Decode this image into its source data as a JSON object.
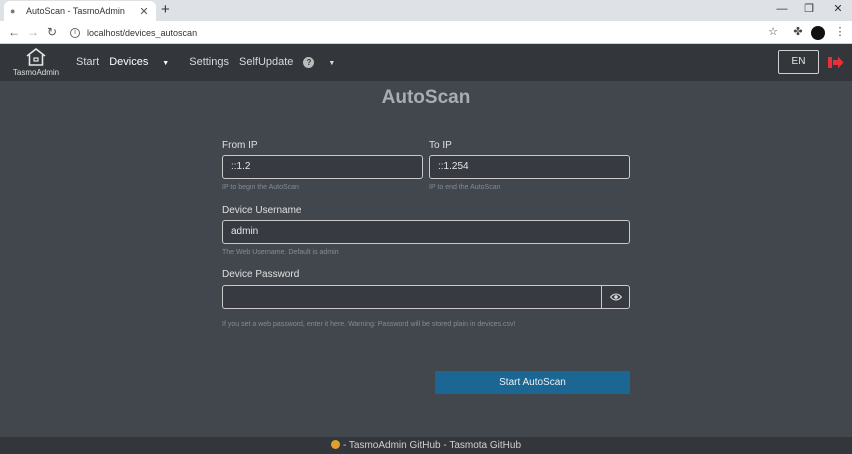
{
  "browser": {
    "tab_title": "AutoScan - TasmoAdmin",
    "tab_close": "✕",
    "new_tab": "+",
    "minimize": "—",
    "restore": "❐",
    "close": "✕",
    "url": "localhost/devices_autoscan"
  },
  "navbar": {
    "brand": "TasmoAdmin",
    "links": {
      "start": "Start",
      "devices": "Devices",
      "settings": "Settings",
      "selfupdate": "SelfUpdate"
    },
    "language": "EN"
  },
  "page": {
    "title": "AutoScan",
    "from_ip": {
      "label": "From IP",
      "value": "::1.2",
      "help": "IP to begin the AutoScan"
    },
    "to_ip": {
      "label": "To IP",
      "value": "::1.254",
      "help": "IP to end the AutoScan"
    },
    "username": {
      "label": "Device Username",
      "value": "admin",
      "help": "The Web Username. Default is admin"
    },
    "password": {
      "label": "Device Password",
      "value": "",
      "help": "If you set a web password, enter it here. Warning: Password will be stored plain in devices.csv!"
    },
    "submit": "Start AutoScan"
  },
  "footer": {
    "text": "- TasmoAdmin GitHub - Tasmota GitHub"
  },
  "colors": {
    "background": "#42464d",
    "navbar": "#33363b",
    "primary_button": "#1b6693",
    "logout_icon": "#e8303a"
  }
}
